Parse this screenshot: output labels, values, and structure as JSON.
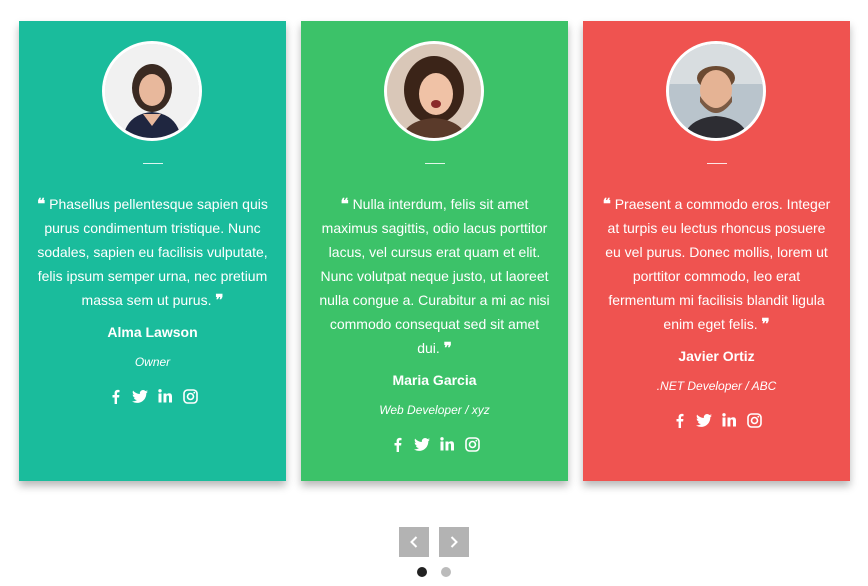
{
  "colors": {
    "card1": "#1abc9c",
    "card2": "#3cc269",
    "card3": "#ef5350",
    "nav_button": "#b3b3b3",
    "dot_active": "#222222",
    "dot_inactive": "#bbbbbb"
  },
  "testimonials": [
    {
      "quote": "Phasellus pellentesque sapien quis purus condimentum tristique. Nunc sodales, sapien eu facilisis vulputate, felis ipsum semper urna, nec pretium massa sem ut purus.",
      "name": "Alma Lawson",
      "role": "Owner"
    },
    {
      "quote": "Nulla interdum, felis sit amet maximus sagittis, odio lacus porttitor lacus, vel cursus erat quam et elit. Nunc volutpat neque justo, ut laoreet nulla congue a. Curabitur a mi ac nisi commodo consequat sed sit amet dui.",
      "name": "Maria Garcia",
      "role": "Web Developer / xyz"
    },
    {
      "quote": "Praesent a commodo eros. Integer at turpis eu lectus rhoncus posuere eu vel purus. Donec mollis, lorem ut porttitor commodo, leo erat fermentum mi facilisis blandit ligula enim eget felis.",
      "name": "Javier Ortiz",
      "role": ".NET Developer / ABC"
    }
  ],
  "quote_open_glyph": "❝",
  "quote_close_glyph": "❞",
  "social_icons": [
    "facebook-icon",
    "twitter-icon",
    "linkedin-icon",
    "instagram-icon"
  ],
  "carousel": {
    "prev_glyph": "‹",
    "next_glyph": "›",
    "total_pages": 2,
    "active_page": 1
  }
}
